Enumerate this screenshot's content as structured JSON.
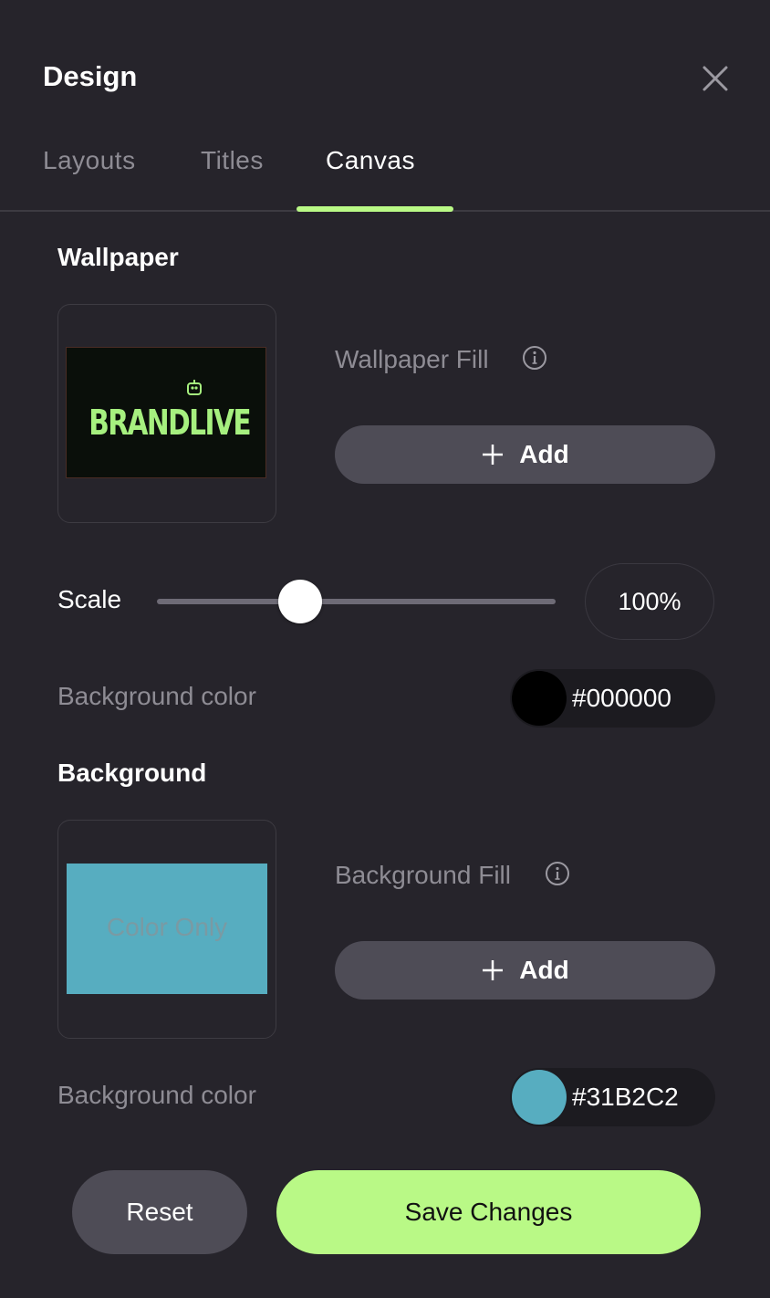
{
  "header": {
    "title": "Design"
  },
  "tabs": [
    {
      "label": "Layouts"
    },
    {
      "label": "Titles"
    },
    {
      "label": "Canvas",
      "active": true
    }
  ],
  "wallpaper": {
    "section_title": "Wallpaper",
    "preview_logo_text": "BRANDLIVE",
    "fill_label": "Wallpaper Fill",
    "add_label": "Add",
    "scale_label": "Scale",
    "scale_value": "100%",
    "scale_fraction": 0.36,
    "bg_color_label": "Background color",
    "bg_color": "#000000",
    "bg_color_text": "#000000"
  },
  "background": {
    "section_title": "Background",
    "preview_text": "Color Only",
    "fill_label": "Background Fill",
    "add_label": "Add",
    "bg_color_label": "Background color",
    "bg_color": "#57adc0",
    "bg_color_text": "#31B2C2"
  },
  "footer": {
    "reset_label": "Reset",
    "save_label": "Save Changes"
  },
  "colors": {
    "accent": "#b9f986",
    "panel_bg": "#26242b",
    "button_bg": "#4e4c56"
  },
  "icons": {
    "close": "close-icon",
    "info": "info-icon",
    "plus": "plus-icon"
  }
}
